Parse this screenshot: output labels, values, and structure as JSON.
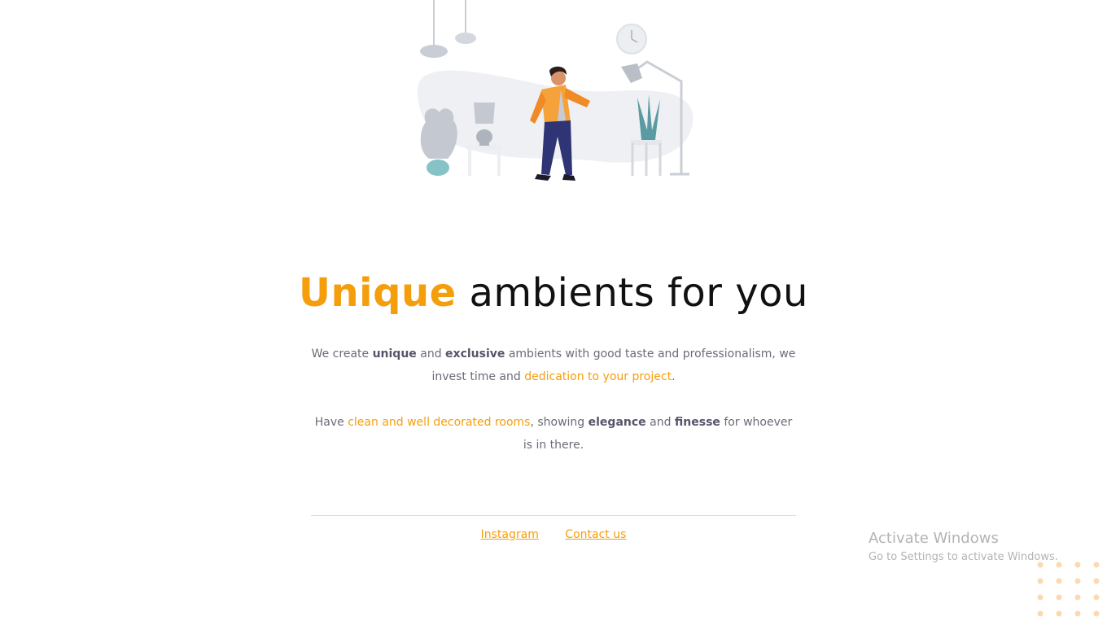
{
  "headline": {
    "accent": "Unique",
    "rest": " ambients for you"
  },
  "paragraph1": {
    "t1": "We create ",
    "b1": "unique",
    "t2": " and ",
    "b2": "exclusive",
    "t3": " ambients with good taste and professionalism, we invest time and ",
    "hl1": "dedication to your project",
    "t4": "."
  },
  "paragraph2": {
    "t1": "Have ",
    "hl1": "clean and well decorated rooms",
    "t2": ", showing ",
    "b1": "elegance",
    "t3": " and ",
    "b2": "finesse",
    "t4": " for whoever is in there."
  },
  "footer": {
    "instagram": "Instagram",
    "contact": "Contact us"
  },
  "windows_watermark": {
    "title": "Activate Windows",
    "subtitle": "Go to Settings to activate Windows."
  },
  "colors": {
    "accent": "#f59e0b",
    "text": "#6b6b7a",
    "heading": "#111111"
  },
  "icons": {
    "illustration": "person-in-living-room-illustration",
    "dots": "decorative-dot-grid"
  }
}
